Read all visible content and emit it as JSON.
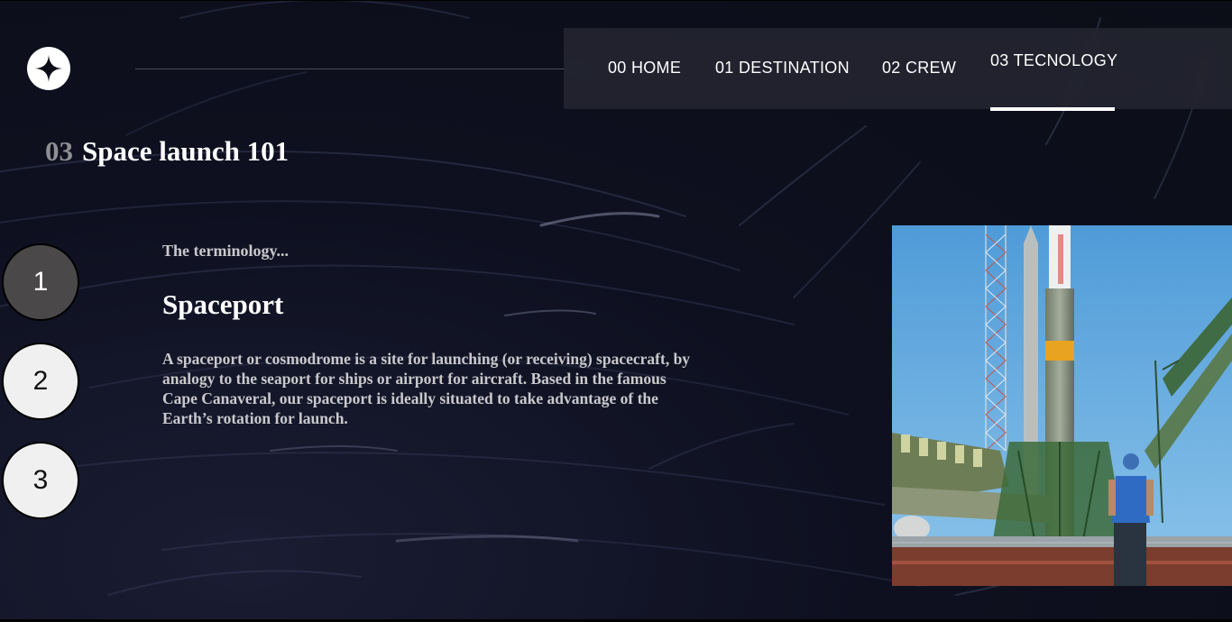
{
  "nav": {
    "items": [
      {
        "num": "00",
        "label": "HOME"
      },
      {
        "num": "01",
        "label": "DESTINATION"
      },
      {
        "num": "02",
        "label": "CREW"
      },
      {
        "num": "03",
        "label": "TECNOLOGY"
      }
    ],
    "active_index": 3
  },
  "page": {
    "number": "03",
    "title": "Space launch 101"
  },
  "steps": [
    "1",
    "2",
    "3"
  ],
  "active_step": 1,
  "content": {
    "kicker": "The terminology...",
    "term": "Spaceport",
    "description": "A spaceport or cosmodrome is a site for launching (or receiving) spacecraft, by analogy to the seaport for ships or airport for aircraft. Based in the famous Cape Canaveral, our spaceport is ideally situated to take advantage of the Earth’s rotation for launch."
  },
  "image": {
    "subject": "rocket-on-launchpad-photo"
  },
  "colors": {
    "background": "#0b0d17",
    "nav_bg": "#282a34",
    "active_step": "#4a4849",
    "inactive_step": "#f0f0f0",
    "muted_text": "#c9c9cc",
    "page_number": "#8e8e93"
  }
}
